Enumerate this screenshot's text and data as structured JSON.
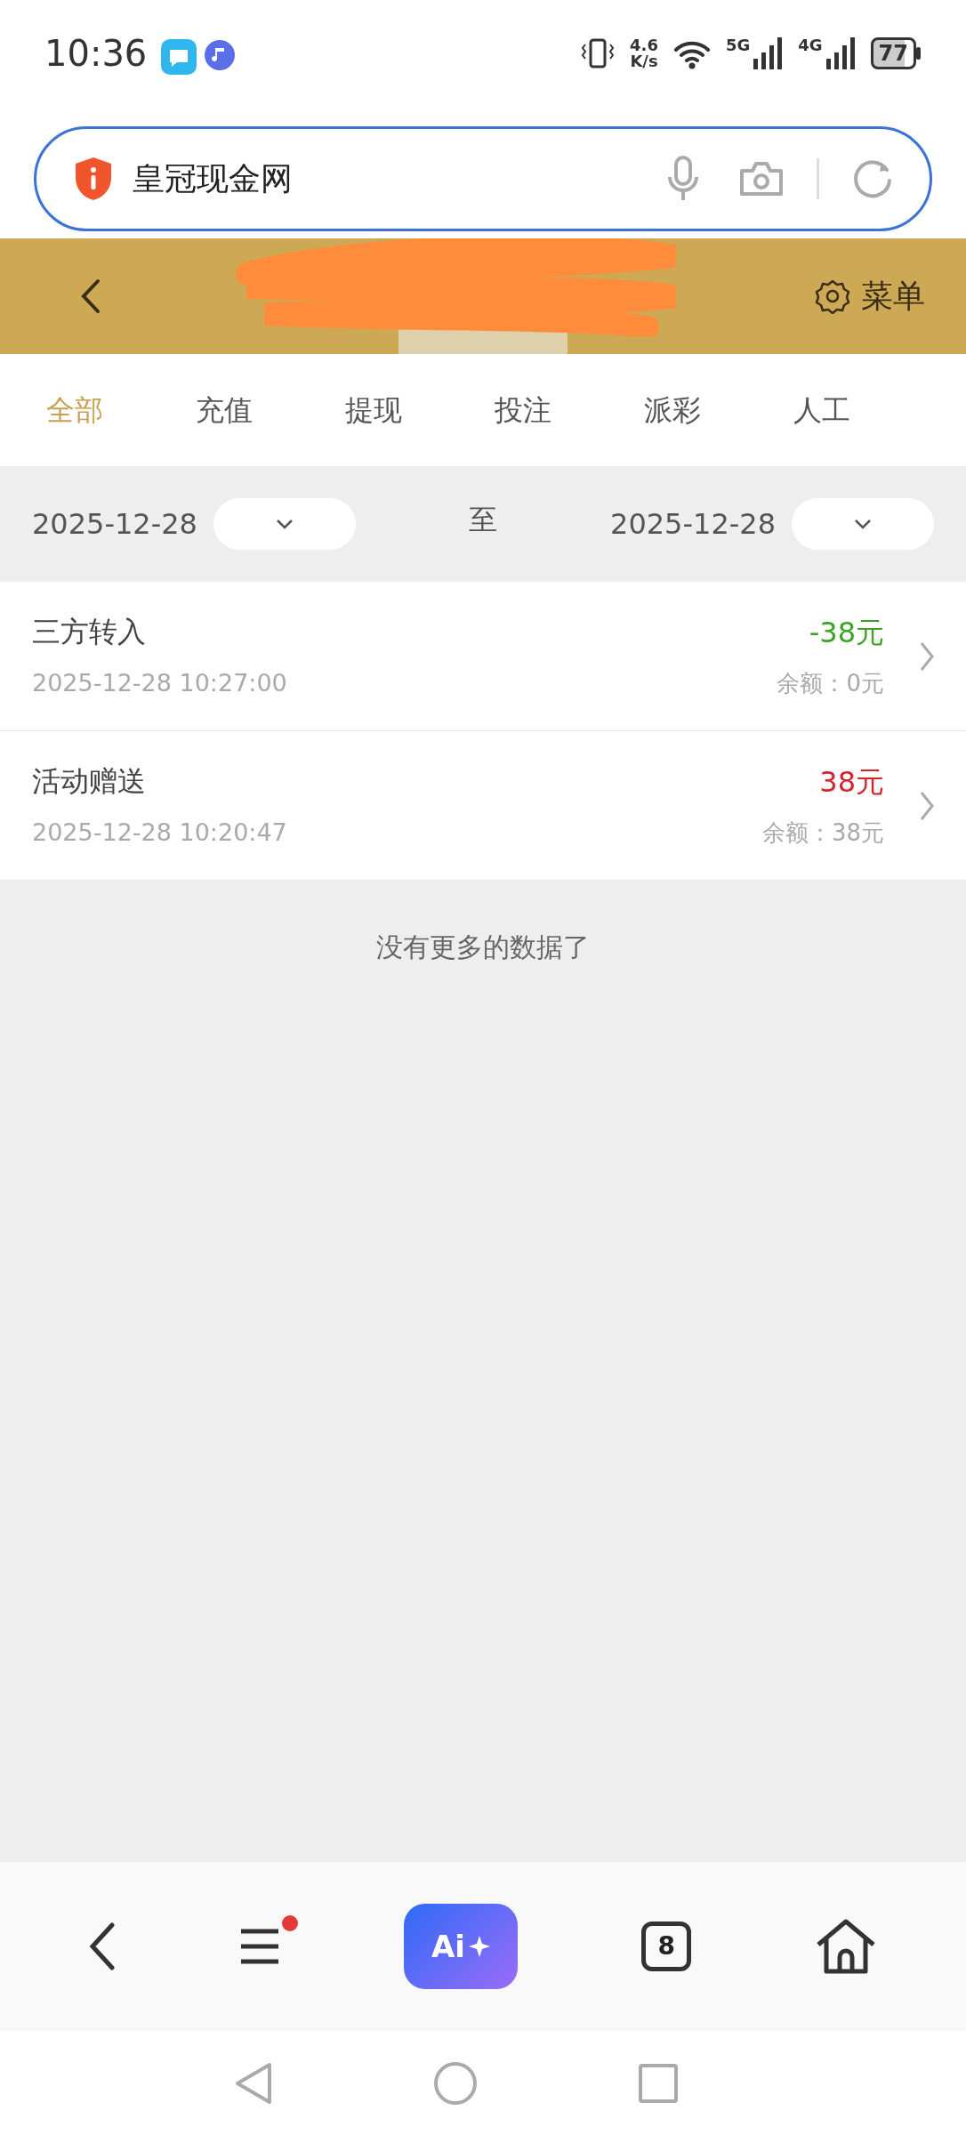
{
  "status_bar": {
    "time": "10:36",
    "net_speed": "4.6",
    "net_unit": "K/s",
    "network_1": "5G",
    "network_2": "4G",
    "battery": "77"
  },
  "address_bar": {
    "value": "皇冠现金网"
  },
  "header": {
    "menu": "菜单"
  },
  "tabs": [
    {
      "label": "全部",
      "selected": true
    },
    {
      "label": "充值",
      "selected": false
    },
    {
      "label": "提现",
      "selected": false
    },
    {
      "label": "投注",
      "selected": false
    },
    {
      "label": "派彩",
      "selected": false
    },
    {
      "label": "人工",
      "selected": false
    }
  ],
  "date_filter": {
    "start": "2025-12-28",
    "separator": "至",
    "end": "2025-12-28"
  },
  "records": [
    {
      "title": "三方转入",
      "time": "2025-12-28 10:27:00",
      "amount": "-38元",
      "kind": "debit",
      "balance": "余额：0元"
    },
    {
      "title": "活动赠送",
      "time": "2025-12-28 10:20:47",
      "amount": "38元",
      "kind": "credit",
      "balance": "余额：38元"
    }
  ],
  "end_message": "没有更多的数据了",
  "browser_bar": {
    "menu_badge": true,
    "ai_label": "Ai",
    "tab_count": "8"
  }
}
